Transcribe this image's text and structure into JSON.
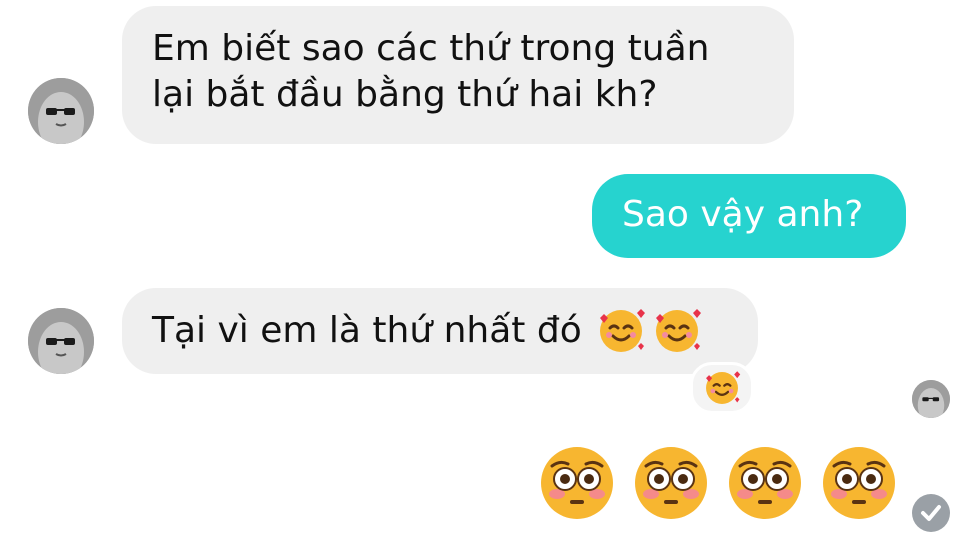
{
  "conversation": {
    "messages": [
      {
        "id": "msg-1",
        "direction": "incoming",
        "lines": [
          "Em biết sao các thứ trong tuần",
          "lại bắt đầu bằng thứ hai kh?"
        ]
      },
      {
        "id": "msg-2",
        "direction": "outgoing",
        "text": "Sao vậy anh?"
      },
      {
        "id": "msg-3",
        "direction": "incoming",
        "text": "Tại vì em là thứ nhất đó",
        "emojis": [
          "smiling-face-with-hearts",
          "smiling-face-with-hearts"
        ],
        "reaction": "smiling-face-with-hearts"
      },
      {
        "id": "msg-4",
        "direction": "outgoing",
        "emojis": [
          "flushed-face",
          "flushed-face",
          "flushed-face",
          "flushed-face"
        ]
      }
    ],
    "read_receipt_icon": "avatar-read-receipt-icon",
    "sent_status_icon": "check-circle-icon"
  },
  "colors": {
    "incoming_bubble": "#efefef",
    "outgoing_bubble": "#26d3cf",
    "text_dark": "#111111",
    "text_light": "#ffffff",
    "emoji_yellow": "#f7b630",
    "heart_red": "#e8334a",
    "check_gray": "#9aa0a6"
  }
}
